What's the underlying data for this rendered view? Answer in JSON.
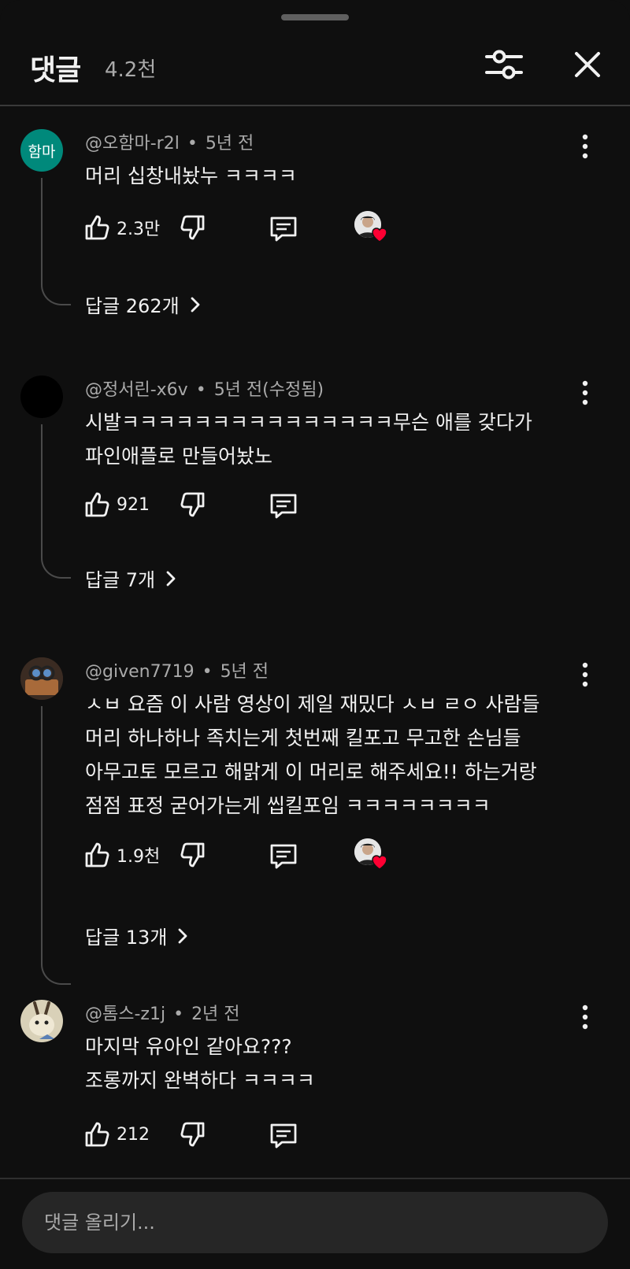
{
  "header": {
    "title": "댓글",
    "count": "4.2천"
  },
  "comments": [
    {
      "author": "@오함마-r2l",
      "time": "5년 전",
      "avatar_text": "함마",
      "lines": [
        "머리 십창내놨누 ㅋㅋㅋㅋ"
      ],
      "likes": "2.3만",
      "creator_hearted": true,
      "replies": "답글 262개"
    },
    {
      "author": "@정서린-x6v",
      "time": "5년 전(수정됨)",
      "lines": [
        "시발ㅋㅋㅋㅋㅋㅋㅋㅋㅋㅋㅋㅋㅋㅋㅋ무슨 애를 갖다가",
        "파인애플로 만들어놨노"
      ],
      "likes": "921",
      "creator_hearted": false,
      "replies": "답글 7개"
    },
    {
      "author": "@given7719",
      "time": "5년 전",
      "lines": [
        "ㅅㅂ 요즘 이 사람 영상이 제일 재밌다 ㅅㅂ ㄹㅇ 사람들",
        "머리 하나하나 족치는게 첫번째 킬포고 무고한 손님들",
        "아무고토 모르고 해맑게 이 머리로 해주세요!! 하는거랑",
        "점점 표정 굳어가는게 씹킬포임 ㅋㅋㅋㅋㅋㅋㅋㅋ"
      ],
      "likes": "1.9천",
      "creator_hearted": true,
      "replies": "답글 13개"
    },
    {
      "author": "@톰스-z1j",
      "time": "2년 전",
      "lines": [
        "마지막 유아인 같아요???",
        "조롱까지 완벽하다 ㅋㅋㅋㅋ"
      ],
      "likes": "212",
      "creator_hearted": false
    }
  ],
  "composer": {
    "placeholder": "댓글 올리기..."
  },
  "colors": {
    "background": "#0f0f0f",
    "text": "#f1f1f1",
    "secondary_text": "#aaaaaa",
    "avatar_teal": "#00897b",
    "heart_red": "#ff0033"
  }
}
